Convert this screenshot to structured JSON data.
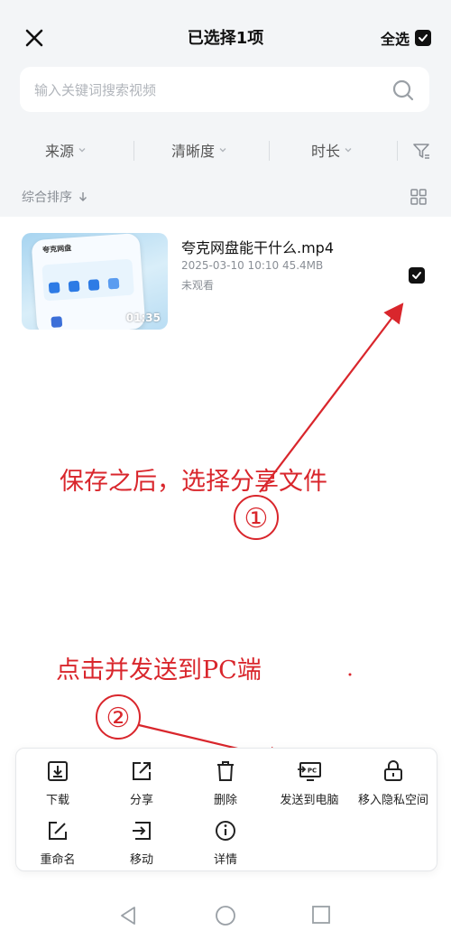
{
  "header": {
    "title": "已选择1项",
    "select_all_label": "全选"
  },
  "search": {
    "placeholder": "输入关键词搜索视频"
  },
  "filters": [
    {
      "label": "来源"
    },
    {
      "label": "清晰度"
    },
    {
      "label": "时长"
    }
  ],
  "sort": {
    "label": "综合排序"
  },
  "video": {
    "thumb_title": "夸克网盘",
    "duration": "01:35",
    "name": "夸克网盘能干什么.mp4",
    "meta": "2025-03-10 10:10 45.4MB",
    "status": "未观看",
    "selected": true
  },
  "annotations": {
    "step1_text": "保存之后，选择分享文件",
    "step1_number": "①",
    "step2_text": "点击并发送到PC端",
    "step2_number": "②",
    "color": "#d9262c"
  },
  "actions": [
    {
      "label": "下载",
      "icon": "download-icon"
    },
    {
      "label": "分享",
      "icon": "share-icon"
    },
    {
      "label": "删除",
      "icon": "trash-icon"
    },
    {
      "label": "发送到电脑",
      "icon": "send-to-pc-icon"
    },
    {
      "label": "移入隐私空间",
      "icon": "lock-icon"
    },
    {
      "label": "重命名",
      "icon": "rename-icon"
    },
    {
      "label": "移动",
      "icon": "move-icon"
    },
    {
      "label": "详情",
      "icon": "info-icon"
    }
  ]
}
